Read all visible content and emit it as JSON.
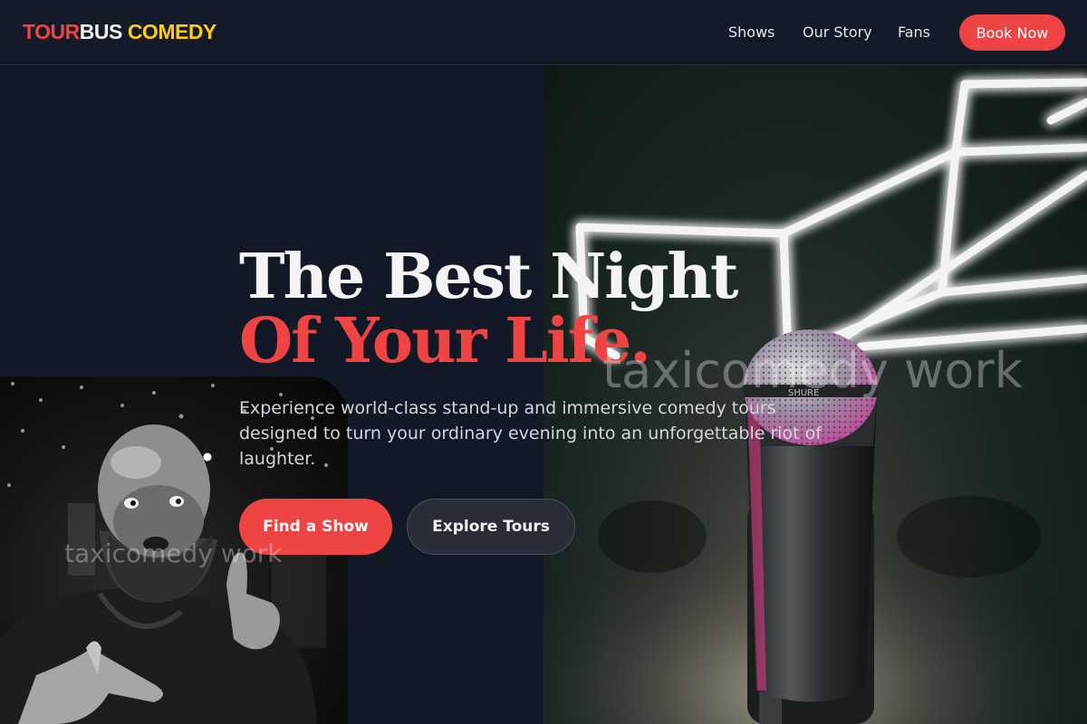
{
  "brand": {
    "part1": "TOUR",
    "part2": "BUS",
    "part3": "COMEDY",
    "colors": {
      "red": "#ef4444",
      "white": "#f2f3f6",
      "yellow": "#facc15"
    }
  },
  "nav": {
    "items": [
      {
        "label": "Shows"
      },
      {
        "label": "Our Story"
      },
      {
        "label": "Fans"
      }
    ],
    "cta": "Book Now"
  },
  "hero": {
    "title_line1": "The Best Night",
    "title_line2": "Of Your Life.",
    "subtitle": "Experience world-class stand-up and immersive comedy tours designed to turn your ordinary evening into an unforgettable riot of laughter.",
    "primary_cta": "Find a Show",
    "secondary_cta": "Explore Tours"
  },
  "images": {
    "mic_watermark": "taxicomedy work",
    "comedian_watermark": "taxicomedy work"
  },
  "theme": {
    "background": "#131826",
    "accent": "#ef4444"
  }
}
